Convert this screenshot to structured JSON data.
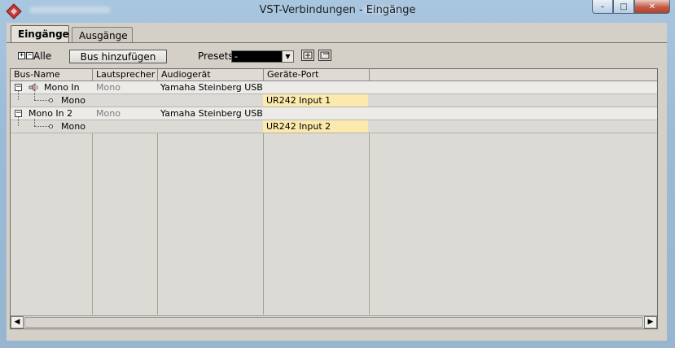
{
  "window": {
    "title": "VST-Verbindungen - Eingänge",
    "controls": {
      "minimize": "–",
      "maximize": "□",
      "close": "✕"
    }
  },
  "tabs": [
    {
      "label": "Eingänge",
      "active": true
    },
    {
      "label": "Ausgänge",
      "active": false
    }
  ],
  "toolbar": {
    "expand_all": "+",
    "collapse_all": "−",
    "all_label": "Alle",
    "add_bus_label": "Bus hinzufügen",
    "presets_label": "Presets",
    "presets_value": "-"
  },
  "table": {
    "columns": [
      "Bus-Name",
      "Lautsprecher",
      "Audiogerät",
      "Geräte-Port"
    ],
    "rows": [
      {
        "bus": "Mono In",
        "speaker": "Mono",
        "device": "Yamaha Steinberg USB A",
        "port": ""
      },
      {
        "bus": "Mono",
        "speaker": "",
        "device": "",
        "port": "UR242 Input 1"
      },
      {
        "bus": "Mono In 2",
        "speaker": "Mono",
        "device": "Yamaha Steinberg USB A",
        "port": ""
      },
      {
        "bus": "Mono",
        "speaker": "",
        "device": "",
        "port": "UR242 Input 2"
      }
    ]
  },
  "colors": {
    "port_highlight": "#fbe9ad",
    "panel_bg": "#d4d0c8",
    "app_icon": "#c23b3b"
  },
  "icons": {
    "app": "cubase-logo-icon",
    "speaker": "speaker-icon",
    "collapse": "minus-box-icon"
  }
}
